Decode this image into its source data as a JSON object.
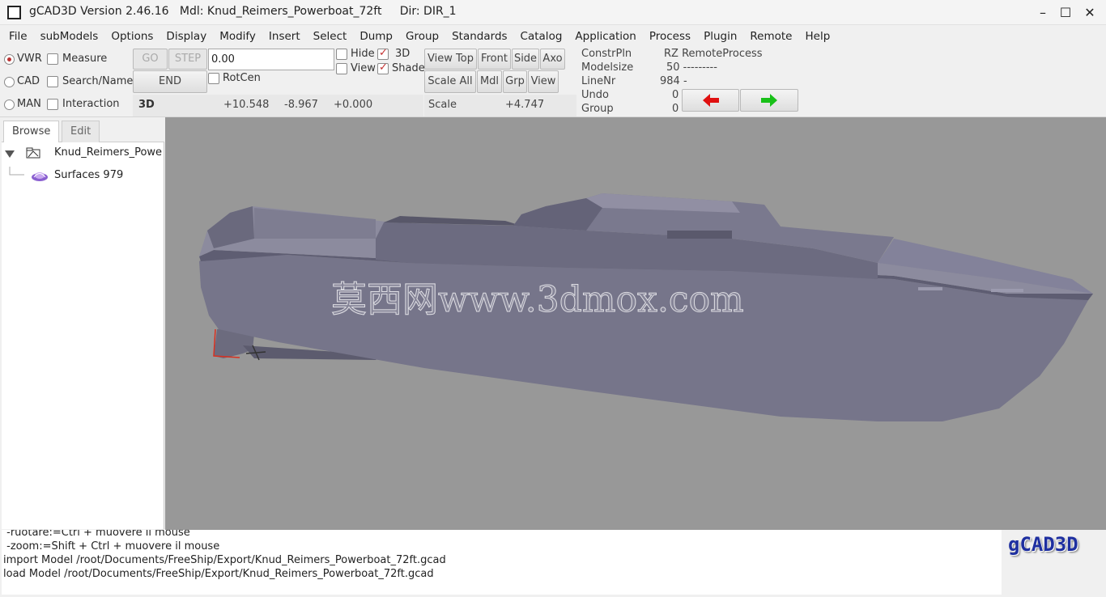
{
  "window": {
    "title": "gCAD3D Version 2.46.16   Mdl: Knud_Reimers_Powerboat_72ft     Dir: DIR_1",
    "minimize": "–",
    "maximize": "☐",
    "close": "✕"
  },
  "menu": [
    "File",
    "subModels",
    "Options",
    "Display",
    "Modify",
    "Insert",
    "Select",
    "Dump",
    "Group",
    "Standards",
    "Catalog",
    "Application",
    "Process",
    "Plugin",
    "Remote",
    "Help"
  ],
  "toolbar": {
    "modes": {
      "vwr": "VWR",
      "cad": "CAD",
      "man": "MAN"
    },
    "checks": {
      "measure": "Measure",
      "search_name": "Search/Name",
      "interaction": "Interaction",
      "rotcen": "RotCen",
      "hide": "Hide",
      "view": "View",
      "threed": "3D",
      "shade": "Shade"
    },
    "buttons": {
      "go": "GO",
      "step": "STEP",
      "end": "END",
      "view_top": "View Top",
      "front": "Front",
      "side": "Side",
      "axo": "Axo",
      "scale_all": "Scale All",
      "mdl": "Mdl",
      "grp": "Grp",
      "view": "View"
    },
    "input_value": "0.00",
    "coords": {
      "mode": "3D",
      "x": "+10.548",
      "y": "-8.967",
      "z": "+0.000"
    },
    "scale_label": "Scale",
    "scale_value": "+4.747",
    "info": {
      "constrpln_label": "ConstrPln",
      "constrpln_value": "RZ RemoteProcess",
      "modelsize_label": "Modelsize",
      "modelsize_value": "50 ---------",
      "linenr_label": "LineNr",
      "linenr_value": "984 -",
      "undo_label": "Undo",
      "undo_value": "0",
      "group_label": "Group",
      "group_value": "0"
    },
    "colors": {
      "arrow_back": "#e01010",
      "arrow_fwd": "#18c018"
    }
  },
  "sidebar": {
    "tabs": [
      "Browse",
      "Edit"
    ],
    "tree": [
      {
        "label": "Knud_Reimers_Powe",
        "icon": "model-icon"
      },
      {
        "label": "Surfaces 979",
        "icon": "surface-icon"
      }
    ]
  },
  "viewport": {
    "watermark": "莫西网www.3dmox.com",
    "colors": {
      "background": "#989898",
      "hull": "#76758a"
    }
  },
  "console": {
    "lines": [
      " -ruotare:=Ctrl + muovere il mouse",
      " -zoom:=Shift + Ctrl + muovere il mouse",
      "import Model /root/Documents/FreeShip/Export/Knud_Reimers_Powerboat_72ft.gcad",
      "load Model /root/Documents/FreeShip/Export/Knud_Reimers_Powerboat_72ft.gcad"
    ],
    "logo": "gCAD3D"
  }
}
